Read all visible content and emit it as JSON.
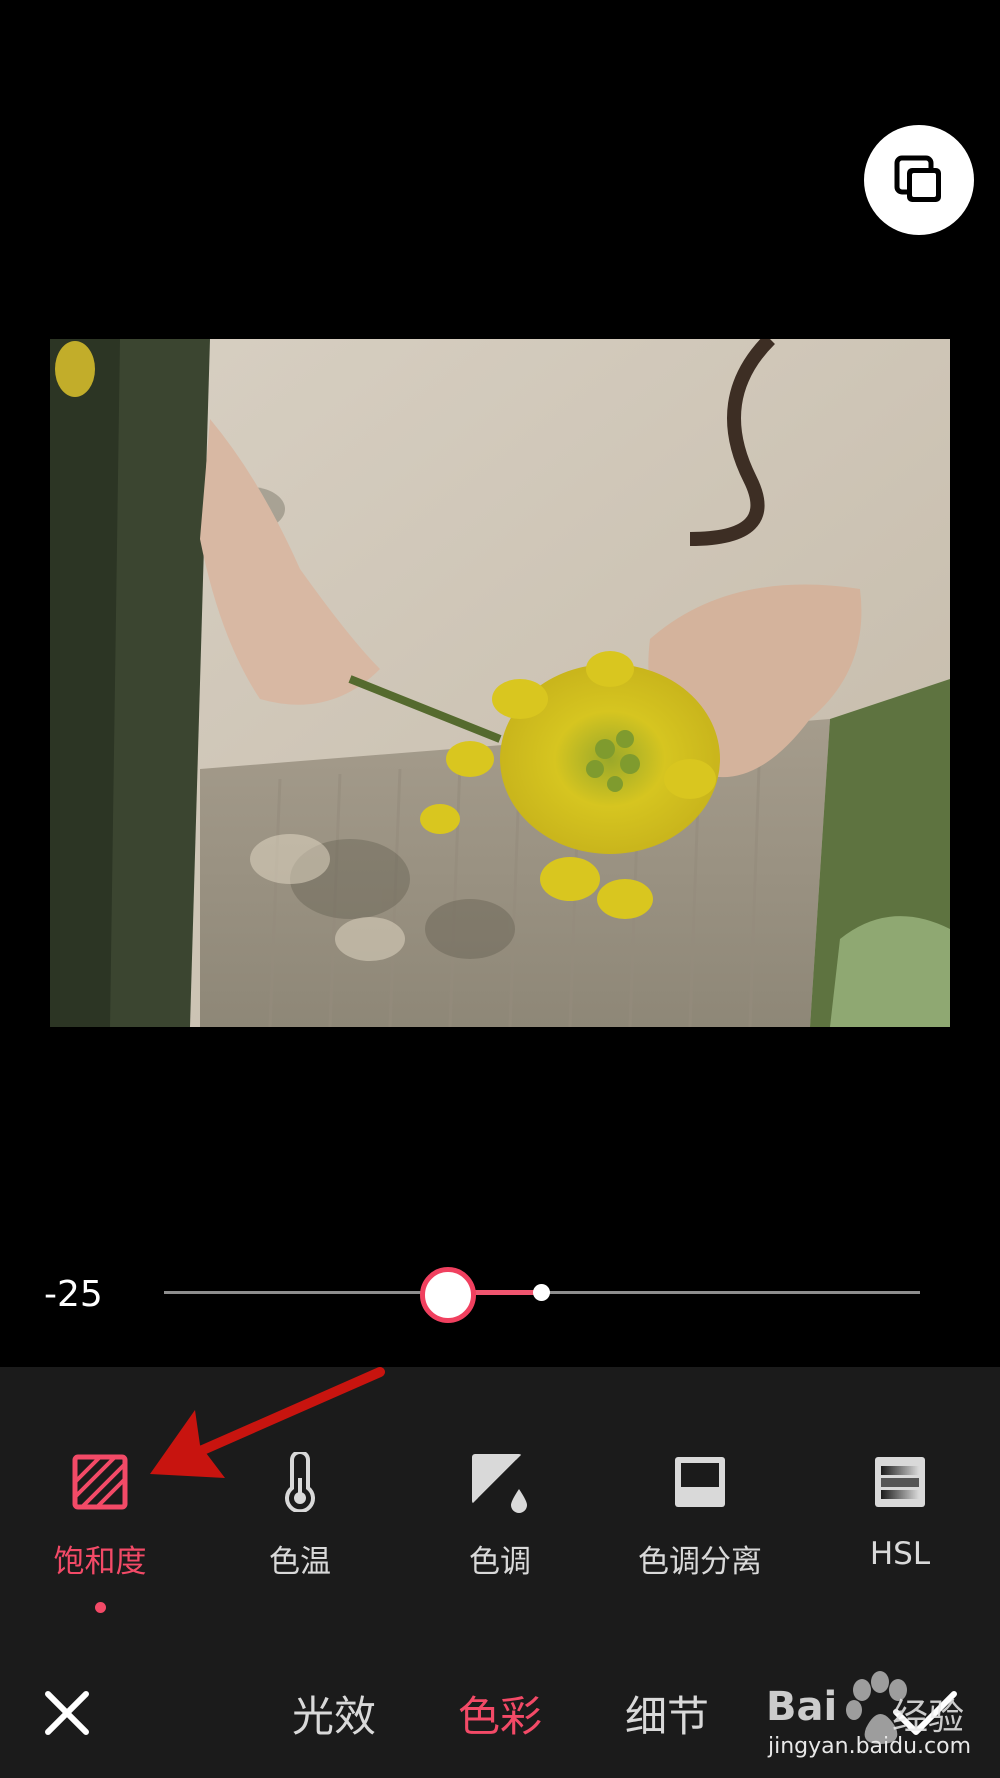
{
  "slider": {
    "value_label": "-25",
    "value": -25
  },
  "tools": [
    {
      "id": "saturation",
      "label": "饱和度",
      "icon": "saturation-icon",
      "active": true
    },
    {
      "id": "temperature",
      "label": "色温",
      "icon": "thermometer-icon",
      "active": false
    },
    {
      "id": "tint",
      "label": "色调",
      "icon": "tint-icon",
      "active": false
    },
    {
      "id": "split-toning",
      "label": "色调分离",
      "icon": "split-toning-icon",
      "active": false
    },
    {
      "id": "hsl",
      "label": "HSL",
      "icon": "hsl-icon",
      "active": false
    }
  ],
  "tabs": [
    {
      "label": "光效",
      "active": false
    },
    {
      "label": "色彩",
      "active": true
    },
    {
      "label": "细节",
      "active": false
    }
  ],
  "actions": {
    "close_icon": "close-icon",
    "confirm_icon": "checkmark-icon",
    "compare_icon": "compare-icon"
  },
  "watermark": {
    "brand": "Bai",
    "brand_cn": "经验",
    "url": "jingyan.baidu.com"
  },
  "colors": {
    "accent": "#f34a67",
    "panel": "#1b1b1b",
    "background": "#000000"
  }
}
